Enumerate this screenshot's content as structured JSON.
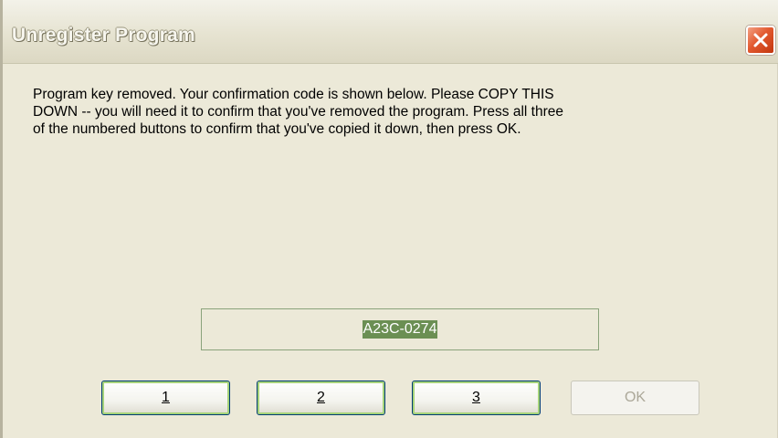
{
  "window": {
    "title": "Unregister Program"
  },
  "message": {
    "line1": "Program key removed. Your confirmation code is shown below. Please COPY THIS",
    "line2": "DOWN -- you will need it to confirm that you've removed the program. Press all three",
    "line3": "of the numbered buttons to confirm that you've copied it down, then press OK."
  },
  "confirmation_code": {
    "value": "A23C-0274"
  },
  "buttons": {
    "one": "1",
    "two": "2",
    "three": "3",
    "ok": "OK"
  },
  "icons": {
    "close": "close-icon"
  },
  "colors": {
    "dialog_background": "#ece9d8",
    "title_text": "#f7f6ef",
    "close_button": "#e2592f",
    "button_hover_border": "#a6d37a",
    "selection_highlight": "#6b8f53",
    "disabled_text": "#aca899"
  }
}
